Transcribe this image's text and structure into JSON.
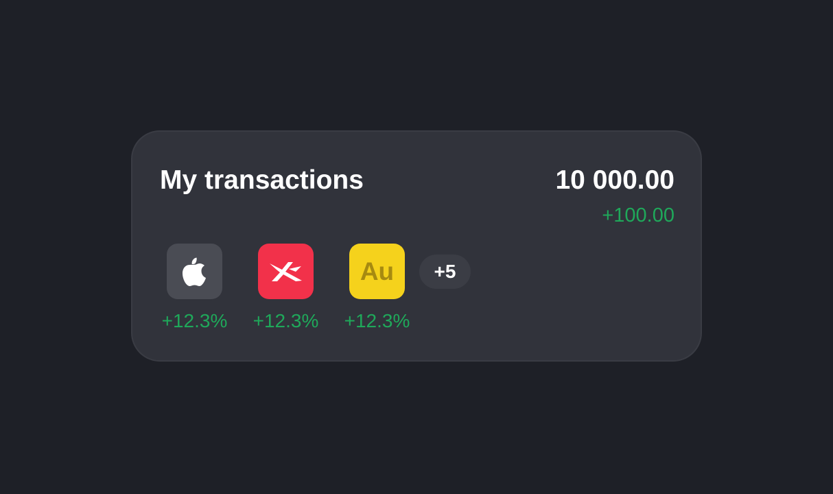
{
  "card": {
    "title": "My transactions",
    "balance": "10 000.00",
    "change": "+100.00"
  },
  "assets": [
    {
      "icon": "apple-logo-icon",
      "bg": "#4a4c54",
      "change": "+12.3%"
    },
    {
      "icon": "x-brand-logo-icon",
      "bg": "#f2314a",
      "change": "+12.3%"
    },
    {
      "icon": "gold-au-icon",
      "bg": "#f5d21c",
      "label": "Au",
      "change": "+12.3%"
    }
  ],
  "more": "+5",
  "colors": {
    "background": "#1e2027",
    "card": "#31333b",
    "positive": "#1fa85a",
    "text": "#ffffff"
  }
}
